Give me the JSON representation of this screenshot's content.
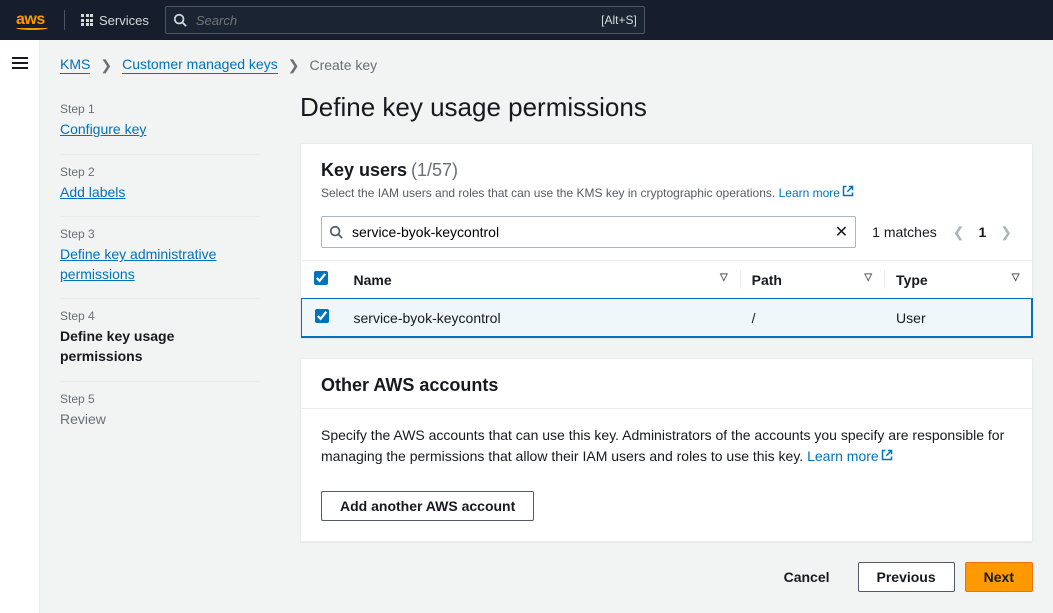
{
  "topnav": {
    "services_label": "Services",
    "search_placeholder": "Search",
    "search_shortcut": "[Alt+S]"
  },
  "breadcrumbs": {
    "items": [
      "KMS",
      "Customer managed keys",
      "Create key"
    ]
  },
  "steps": [
    {
      "label": "Step 1",
      "title": "Configure key",
      "state": "done"
    },
    {
      "label": "Step 2",
      "title": "Add labels",
      "state": "done"
    },
    {
      "label": "Step 3",
      "title": "Define key administrative permissions",
      "state": "done"
    },
    {
      "label": "Step 4",
      "title": "Define key usage permissions",
      "state": "active"
    },
    {
      "label": "Step 5",
      "title": "Review",
      "state": "future"
    }
  ],
  "page_title": "Define key usage permissions",
  "key_users": {
    "title": "Key users",
    "count": "(1/57)",
    "desc": "Select the IAM users and roles that can use the KMS key in cryptographic operations.",
    "learn_more": "Learn more",
    "filter_value": "service-byok-keycontrol",
    "matches": "1 matches",
    "page_number": "1",
    "columns": {
      "name": "Name",
      "path": "Path",
      "type": "Type"
    },
    "rows": [
      {
        "name": "service-byok-keycontrol",
        "path": "/",
        "type": "User",
        "selected": true
      }
    ]
  },
  "other_accounts": {
    "title": "Other AWS accounts",
    "desc": "Specify the AWS accounts that can use this key. Administrators of the accounts you specify are responsible for managing the permissions that allow their IAM users and roles to use this key.",
    "learn_more": "Learn more",
    "add_button": "Add another AWS account"
  },
  "footer": {
    "cancel": "Cancel",
    "previous": "Previous",
    "next": "Next"
  }
}
